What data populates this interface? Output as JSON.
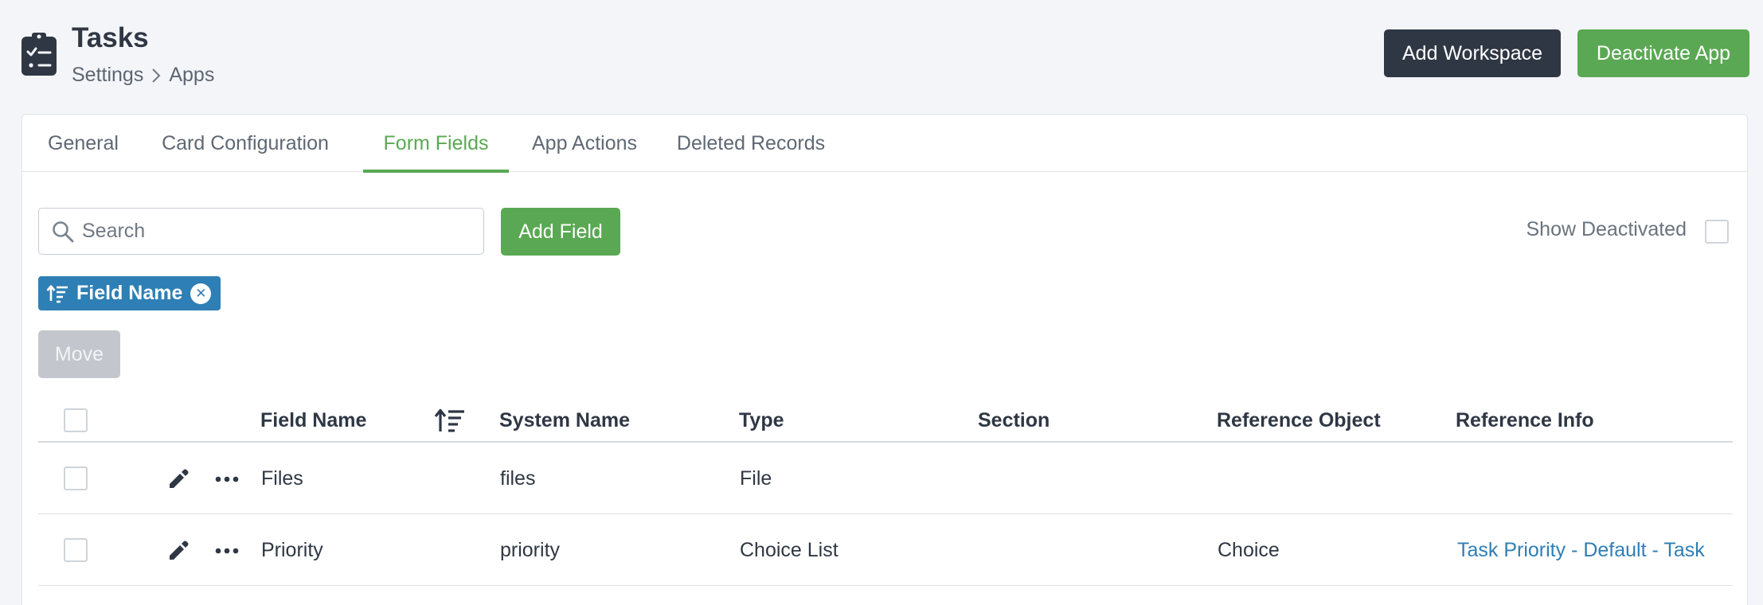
{
  "header": {
    "app_icon": "clipboard-checklist-icon",
    "title": "Tasks",
    "breadcrumb": [
      "Settings",
      "Apps"
    ],
    "add_workspace_label": "Add Workspace",
    "deactivate_label": "Deactivate App"
  },
  "tabs": [
    {
      "label": "General"
    },
    {
      "label": "Card Configuration"
    },
    {
      "label": "Form Fields",
      "active": true
    },
    {
      "label": "App Actions"
    },
    {
      "label": "Deleted Records"
    }
  ],
  "toolbar": {
    "search_placeholder": "Search",
    "search_value": "",
    "add_field_label": "Add Field",
    "show_deactivated_label": "Show Deactivated",
    "show_deactivated_checked": false,
    "move_label": "Move"
  },
  "sort_chip": {
    "label": "Field Name",
    "icon": "sort-ascending-icon",
    "close_icon": "close-icon"
  },
  "table": {
    "columns": [
      "Field Name",
      "System Name",
      "Type",
      "Section",
      "Reference Object",
      "Reference Info"
    ],
    "rows": [
      {
        "field_name": "Files",
        "system_name": "files",
        "type": "File",
        "section": "",
        "reference_object": "",
        "reference_info": ""
      },
      {
        "field_name": "Priority",
        "system_name": "priority",
        "type": "Choice List",
        "section": "",
        "reference_object": "Choice",
        "reference_info": "Task Priority - Default - Task"
      }
    ]
  },
  "colors": {
    "primary_green": "#5aa853",
    "dark": "#2f3744",
    "link_blue": "#2e7fb5",
    "disabled": "#c3c7cd",
    "background": "#f4f5f9"
  }
}
